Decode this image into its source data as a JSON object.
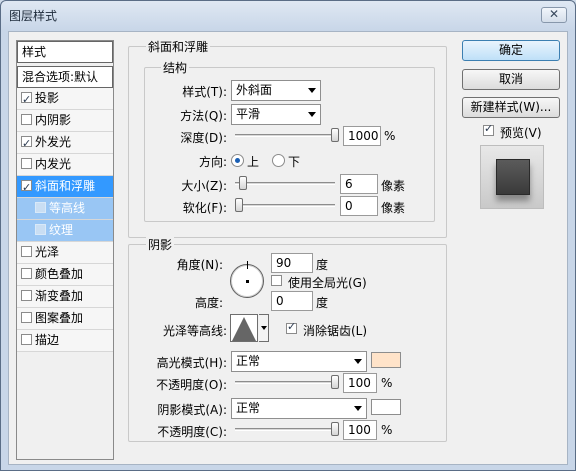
{
  "window": {
    "title": "图层样式",
    "close_glyph": "✕"
  },
  "sidebar": {
    "items": [
      {
        "label": "样式",
        "checkbox": false,
        "checked": false
      },
      {
        "label": "混合选项:默认",
        "checkbox": false,
        "checked": false
      },
      {
        "label": "投影",
        "checkbox": true,
        "checked": true
      },
      {
        "label": "内阴影",
        "checkbox": true,
        "checked": false
      },
      {
        "label": "外发光",
        "checkbox": true,
        "checked": true
      },
      {
        "label": "内发光",
        "checkbox": true,
        "checked": false
      },
      {
        "label": "斜面和浮雕",
        "checkbox": true,
        "checked": true
      },
      {
        "label": "等高线",
        "checkbox": true,
        "checked": false
      },
      {
        "label": "纹理",
        "checkbox": true,
        "checked": false
      },
      {
        "label": "光泽",
        "checkbox": true,
        "checked": false
      },
      {
        "label": "颜色叠加",
        "checkbox": true,
        "checked": false
      },
      {
        "label": "渐变叠加",
        "checkbox": true,
        "checked": false
      },
      {
        "label": "图案叠加",
        "checkbox": true,
        "checked": false
      },
      {
        "label": "描边",
        "checkbox": true,
        "checked": false
      }
    ]
  },
  "bevel": {
    "group_title": "斜面和浮雕",
    "structure_title": "结构",
    "style_label": "样式(T):",
    "style_value": "外斜面",
    "method_label": "方法(Q):",
    "method_value": "平滑",
    "depth_label": "深度(D):",
    "depth_value": "1000",
    "depth_unit": "%",
    "depth_level": 1.0,
    "direction_label": "方向:",
    "direction_up": "上",
    "direction_down": "下",
    "size_label": "大小(Z):",
    "size_value": "6",
    "size_unit": "像素",
    "size_level": 0.04,
    "soften_label": "软化(F):",
    "soften_value": "0",
    "soften_unit": "像素",
    "soften_level": 0.0
  },
  "shading": {
    "title": "阴影",
    "angle_label": "角度(N):",
    "angle_value": "90",
    "angle_unit": "度",
    "global_light_label": "使用全局光(G)",
    "global_light_checked": false,
    "altitude_label": "高度:",
    "altitude_value": "0",
    "altitude_unit": "度",
    "gloss_contour_label": "光泽等高线:",
    "anti_alias_label": "消除锯齿(L)",
    "anti_alias_checked": true,
    "highlight_mode_label": "高光模式(H):",
    "highlight_mode_value": "正常",
    "highlight_color": "#ffe3c9",
    "highlight_opacity_label": "不透明度(O):",
    "highlight_opacity_value": "100",
    "highlight_opacity_unit": "%",
    "highlight_opacity_level": 1.0,
    "shadow_mode_label": "阴影模式(A):",
    "shadow_mode_value": "正常",
    "shadow_color": "#ffffff",
    "shadow_opacity_label": "不透明度(C):",
    "shadow_opacity_value": "100",
    "shadow_opacity_unit": "%",
    "shadow_opacity_level": 1.0
  },
  "actions": {
    "ok": "确定",
    "cancel": "取消",
    "new_style": "新建样式(W)...",
    "preview_label": "预览(V)",
    "preview_checked": true
  }
}
